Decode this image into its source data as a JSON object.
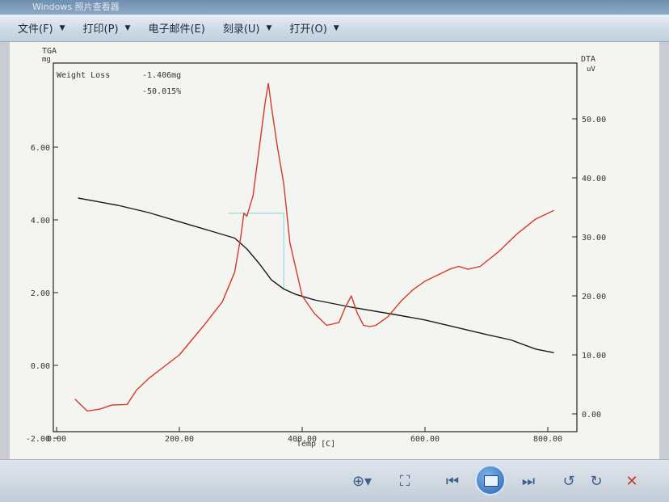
{
  "window": {
    "title": "Windows 照片查看器"
  },
  "menubar": {
    "items": [
      {
        "label": "文件(F)",
        "name": "menu-file"
      },
      {
        "label": "打印(P)",
        "name": "menu-print"
      },
      {
        "label": "电子邮件(E)",
        "name": "menu-email"
      },
      {
        "label": "刻录(U)",
        "name": "menu-burn"
      },
      {
        "label": "打开(O)",
        "name": "menu-open"
      }
    ]
  },
  "toolbar": {
    "icons": [
      "zoom-icon",
      "fit-window-icon",
      "previous-icon",
      "slideshow-icon",
      "next-icon",
      "rotate-left-icon",
      "rotate-right-icon",
      "delete-icon"
    ]
  },
  "chart_data": {
    "type": "line",
    "left_axis": {
      "label": "TGA",
      "unit": "mg",
      "ylim": [
        -2.0,
        7.0
      ],
      "ticks": [
        "-2.00",
        "0.00",
        "2.00",
        "4.00",
        "6.00"
      ]
    },
    "right_axis": {
      "label": "DTA",
      "unit": "uV",
      "ylim": [
        0.0,
        55.0
      ],
      "ticks": [
        "0.00",
        "10.00",
        "20.00",
        "30.00",
        "40.00",
        "50.00"
      ]
    },
    "x_axis": {
      "label": "Temp [C]",
      "xlim": [
        0,
        850
      ],
      "ticks": [
        "0.00",
        "200.00",
        "400.00",
        "600.00",
        "800.00"
      ]
    },
    "annotation": {
      "label": "Weight Loss",
      "value_mg": "-1.406mg",
      "value_pct": "-50.015%"
    },
    "series": [
      {
        "axis": "left",
        "color": "#1a1a1a",
        "x": [
          35,
          100,
          150,
          200,
          250,
          290,
          310,
          330,
          350,
          370,
          390,
          420,
          480,
          550,
          600,
          650,
          700,
          740,
          780,
          810
        ],
        "y": [
          4.6,
          4.4,
          4.2,
          3.95,
          3.7,
          3.5,
          3.2,
          2.8,
          2.35,
          2.1,
          1.95,
          1.8,
          1.6,
          1.4,
          1.25,
          1.05,
          0.85,
          0.7,
          0.45,
          0.35
        ]
      },
      {
        "axis": "right",
        "color": "#d43a2a",
        "x": [
          30,
          50,
          70,
          90,
          115,
          130,
          150,
          200,
          240,
          270,
          290,
          300,
          305,
          310,
          320,
          330,
          340,
          345,
          350,
          360,
          370,
          380,
          400,
          420,
          440,
          460,
          470,
          480,
          490,
          500,
          510,
          520,
          540,
          560,
          580,
          600,
          620,
          640,
          655,
          670,
          690,
          720,
          750,
          780,
          810
        ],
        "y": [
          2.5,
          0.5,
          0.8,
          1.5,
          1.6,
          4,
          6,
          10,
          15,
          19,
          24,
          30,
          34,
          33.5,
          37,
          45,
          53,
          56,
          52,
          45,
          39,
          29,
          20,
          17,
          15,
          15.5,
          18,
          20,
          17,
          15,
          14.8,
          15,
          16.5,
          19,
          21,
          22.5,
          23.5,
          24.5,
          25,
          24.5,
          25,
          27.5,
          30.5,
          33,
          34.5
        ]
      }
    ],
    "baseline": {
      "color": "#7fd6d6",
      "x": [
        280,
        370
      ],
      "y_right": [
        34,
        34
      ]
    }
  }
}
